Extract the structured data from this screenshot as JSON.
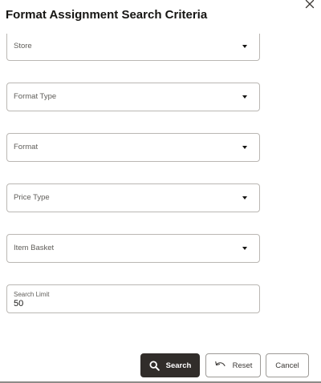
{
  "dialog": {
    "title": "Format Assignment Search Criteria",
    "close_icon": "close-icon"
  },
  "fields": {
    "store": {
      "label": "Store"
    },
    "format_type": {
      "label": "Format Type"
    },
    "format": {
      "label": "Format"
    },
    "price_type": {
      "label": "Price Type"
    },
    "item_basket": {
      "label": "Item Basket"
    },
    "search_limit": {
      "label": "Search Limit",
      "value": "50"
    }
  },
  "footer": {
    "search_label": "Search",
    "search_icon": "search-icon",
    "reset_label": "Reset",
    "reset_icon": "undo-icon",
    "cancel_label": "Cancel"
  },
  "colors": {
    "primary_button": "#312d2a",
    "border": "#bab7b3",
    "text": "#161513"
  }
}
